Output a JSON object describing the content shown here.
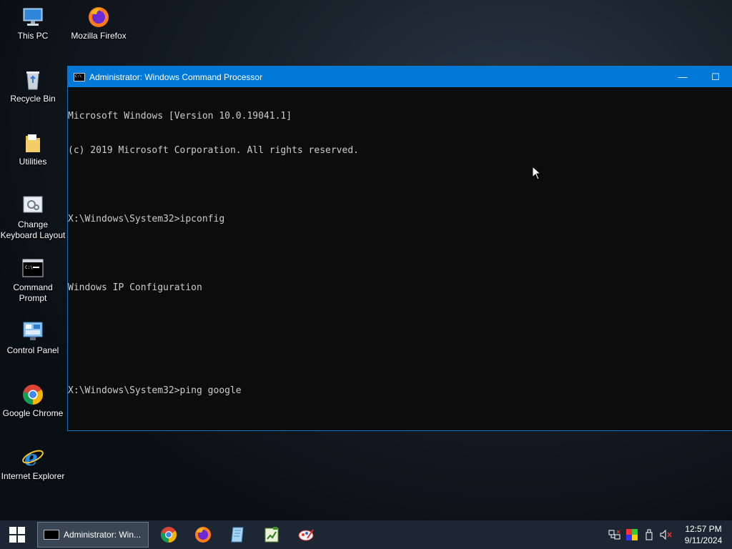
{
  "desktop": {
    "icons": [
      {
        "label": "This PC",
        "icon": "computer-icon"
      },
      {
        "label": "Mozilla Firefox",
        "icon": "firefox-icon"
      },
      {
        "label": "Recycle Bin",
        "icon": "recycle-bin-icon"
      },
      {
        "label": "Utilities",
        "icon": "folder-icon"
      },
      {
        "label_line1": "Change",
        "label_line2": "Keyboard Layout",
        "icon": "keyboard-layout-icon"
      },
      {
        "label_line1": "Command",
        "label_line2": "Prompt",
        "icon": "command-prompt-icon"
      },
      {
        "label": "Control Panel",
        "icon": "control-panel-icon"
      },
      {
        "label": "Google Chrome",
        "icon": "chrome-icon"
      },
      {
        "label": "Internet Explorer",
        "icon": "internet-explorer-icon"
      }
    ]
  },
  "window": {
    "title": "Administrator: Windows Command Processor",
    "minimize": "—",
    "maximize": "☐",
    "console_lines": [
      "Microsoft Windows [Version 10.0.19041.1]",
      "(c) 2019 Microsoft Corporation. All rights reserved.",
      "",
      "X:\\Windows\\System32>ipconfig",
      "",
      "Windows IP Configuration",
      "",
      "",
      "X:\\Windows\\System32>ping google"
    ]
  },
  "taskbar": {
    "active_task_label": "Administrator: Win...",
    "pinned": [
      "chrome-icon",
      "firefox-icon",
      "notepad-icon",
      "spreadsheet-icon",
      "paint-icon"
    ],
    "clock_time": "12:57 PM",
    "clock_date": "9/11/2024"
  },
  "colors": {
    "titlebar": "#0078d7",
    "console_bg": "#0c0c0c",
    "console_text": "#cccccc",
    "taskbar": "#1c2733"
  }
}
